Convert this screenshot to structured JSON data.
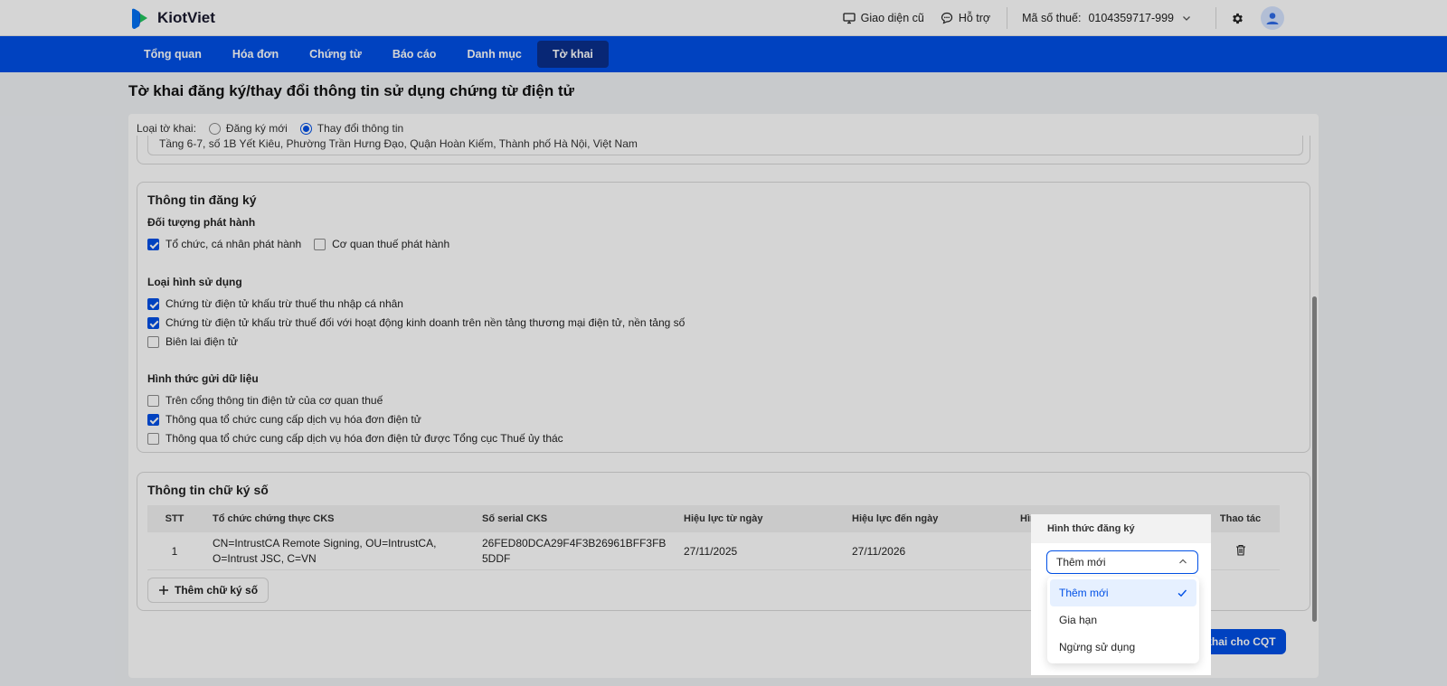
{
  "app": {
    "name": "KiotViet"
  },
  "topbar": {
    "old_ui": "Giao diện cũ",
    "support": "Hỗ trợ",
    "tax_code_label": "Mã số thuế:",
    "tax_code_value": "0104359717-999"
  },
  "nav": {
    "items": [
      {
        "label": "Tổng quan",
        "active": false
      },
      {
        "label": "Hóa đơn",
        "active": false
      },
      {
        "label": "Chứng từ",
        "active": false
      },
      {
        "label": "Báo cáo",
        "active": false
      },
      {
        "label": "Danh mục",
        "active": false
      },
      {
        "label": "Tờ khai",
        "active": true
      }
    ]
  },
  "page": {
    "title": "Tờ khai đăng ký/thay đổi thông tin sử dụng chứng từ điện tử"
  },
  "form_type": {
    "label": "Loại tờ khai:",
    "options": [
      {
        "label": "Đăng ký mới",
        "selected": false
      },
      {
        "label": "Thay đổi thông tin",
        "selected": true
      }
    ]
  },
  "address": {
    "value": "Tầng 6-7, số 1B Yết Kiêu, Phường Trần Hưng Đạo, Quận Hoàn Kiếm, Thành phố Hà Nội, Việt Nam"
  },
  "registration": {
    "title": "Thông tin đăng ký",
    "issuer": {
      "title": "Đối tượng phát hành",
      "options": [
        {
          "label": "Tổ chức, cá nhân phát hành",
          "checked": true
        },
        {
          "label": "Cơ quan thuế phát hành",
          "checked": false
        }
      ]
    },
    "usage": {
      "title": "Loại hình sử dụng",
      "options": [
        {
          "label": "Chứng từ điện tử khấu trừ thuế thu nhập cá nhân",
          "checked": true
        },
        {
          "label": "Chứng từ điện tử khấu trừ thuế đối với hoạt động kinh doanh trên nền tảng thương mại điện tử, nền tảng số",
          "checked": true
        },
        {
          "label": "Biên lai điện tử",
          "checked": false
        }
      ]
    },
    "send": {
      "title": "Hình thức gửi dữ liệu",
      "options": [
        {
          "label": "Trên cổng thông tin điện tử của cơ quan thuế",
          "checked": false
        },
        {
          "label": "Thông qua tổ chức cung cấp dịch vụ hóa đơn điện tử",
          "checked": true
        },
        {
          "label": "Thông qua tổ chức cung cấp dịch vụ hóa đơn điện tử được Tổng cục Thuế ủy thác",
          "checked": false
        }
      ]
    }
  },
  "signature": {
    "title": "Thông tin chữ ký số",
    "columns": [
      "STT",
      "Tổ chức chứng thực CKS",
      "Số serial CKS",
      "Hiệu lực từ ngày",
      "Hiệu lực đến ngày",
      "Hình thức đăng ký",
      "Thao tác"
    ],
    "rows": [
      {
        "stt": "1",
        "org_line1": "CN=IntrustCA Remote Signing, OU=IntrustCA,",
        "org_line2": "O=Intrust JSC, C=VN",
        "serial_line1": "26FED80DCA29F4F3B26961BFF3FB",
        "serial_line2": "5DDF",
        "from": "27/11/2025",
        "to": "27/11/2026",
        "reg_type": "Thêm mới"
      }
    ],
    "add_button": "Thêm chữ ký số"
  },
  "dropdown": {
    "options": [
      {
        "label": "Thêm mới",
        "selected": true
      },
      {
        "label": "Gia hạn",
        "selected": false
      },
      {
        "label": "Ngừng sử dụng",
        "selected": false
      }
    ]
  },
  "footer": {
    "submit_label": "ộp tờ khai cho CQT"
  },
  "colors": {
    "primary": "#0050e6",
    "nav_active": "#0a2f8c"
  }
}
